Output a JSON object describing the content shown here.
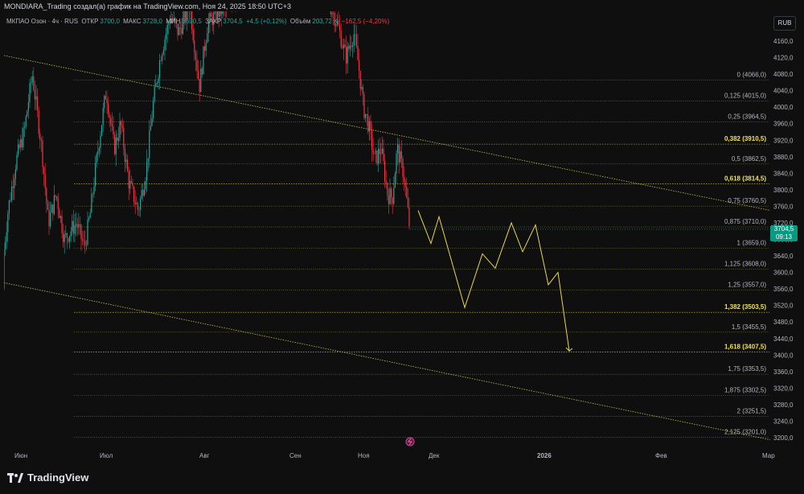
{
  "header": {
    "title": "MONDIARA_Trading создал(а) график на TradingView.com, Ноя 24, 2025 18:50 UTC+3"
  },
  "legend": {
    "symbol": "МКПАО Озон · 4ч · RUS",
    "open_label": "ОТКР",
    "open": "3700,0",
    "high_label": "МАКС",
    "high": "3728,0",
    "low_label": "МИН",
    "low": "3690,5",
    "close_label": "ЗАКР",
    "close": "3704,5",
    "change": "+4,5 (+0,12%)",
    "volume_label": "Объём",
    "volume": "203,72 K",
    "volume_change": "−162,5 (−4,20%)"
  },
  "currency": "RUB",
  "price_tag": {
    "price": "3704,5",
    "countdown": "09:13"
  },
  "footer": {
    "brand": "TradingView"
  },
  "colors": {
    "background": "#0f0f0f",
    "up": "#26a69a",
    "down": "#f23645",
    "fib_line": "#bdbd3c",
    "fib_key": "#f2e24a",
    "projection": "#e8d84a",
    "trendline": "#d9d05a"
  },
  "chart_data": {
    "type": "candlestick",
    "title": "",
    "ylim": [
      3180,
      4200
    ],
    "y_ticks": [
      "4160,0",
      "4120,0",
      "4080,0",
      "4040,0",
      "4000,0",
      "3960,0",
      "3920,0",
      "3880,0",
      "3840,0",
      "3800,0",
      "3760,0",
      "3720,0",
      "3680,0",
      "3640,0",
      "3600,0",
      "3560,0",
      "3520,0",
      "3480,0",
      "3440,0",
      "3400,0",
      "3360,0",
      "3320,0",
      "3280,0",
      "3240,0",
      "3200,0"
    ],
    "x_ticks": [
      "Июн",
      "Июл",
      "Авг",
      "Сен",
      "Ноя",
      "Дек",
      "2026",
      "Фев",
      "Мар"
    ],
    "fib_levels": [
      {
        "label": "0 (4066,0)",
        "value": 4066.0,
        "key": false
      },
      {
        "label": "0,125 (4015,0)",
        "value": 4015.0,
        "key": false
      },
      {
        "label": "0,25 (3964,5)",
        "value": 3964.5,
        "key": false
      },
      {
        "label": "0,382 (3910,5)",
        "value": 3910.5,
        "key": true
      },
      {
        "label": "0,5 (3862,5)",
        "value": 3862.5,
        "key": false
      },
      {
        "label": "0,618 (3814,5)",
        "value": 3814.5,
        "key": true
      },
      {
        "label": "0,75 (3760,5)",
        "value": 3760.5,
        "key": false
      },
      {
        "label": "0,875 (3710,0)",
        "value": 3710.0,
        "key": false
      },
      {
        "label": "1 (3659,0)",
        "value": 3659.0,
        "key": false
      },
      {
        "label": "1,125 (3608,0)",
        "value": 3608.0,
        "key": false
      },
      {
        "label": "1,25 (3557,0)",
        "value": 3557.0,
        "key": false
      },
      {
        "label": "1,382 (3503,5)",
        "value": 3503.5,
        "key": true
      },
      {
        "label": "1,5 (3455,5)",
        "value": 3455.5,
        "key": false
      },
      {
        "label": "1,618 (3407,5)",
        "value": 3407.5,
        "key": true
      },
      {
        "label": "1,75 (3353,5)",
        "value": 3353.5,
        "key": false
      },
      {
        "label": "1,875 (3302,5)",
        "value": 3302,
        "key": false
      },
      {
        "label": "2 (3251,5)",
        "value": 3251.5,
        "key": false
      },
      {
        "label": "2,125 (3201,0)",
        "value": 3201.0,
        "key": false
      }
    ],
    "price_anchors": [
      {
        "t": 0,
        "p": 3560
      },
      {
        "t": 10,
        "p": 3750
      },
      {
        "t": 20,
        "p": 3870
      },
      {
        "t": 30,
        "p": 3940
      },
      {
        "t": 40,
        "p": 4080
      },
      {
        "t": 52,
        "p": 3900
      },
      {
        "t": 60,
        "p": 3720
      },
      {
        "t": 70,
        "p": 3790
      },
      {
        "t": 80,
        "p": 3680
      },
      {
        "t": 95,
        "p": 3720
      },
      {
        "t": 105,
        "p": 3660
      },
      {
        "t": 112,
        "p": 3740
      },
      {
        "t": 122,
        "p": 3900
      },
      {
        "t": 132,
        "p": 4040
      },
      {
        "t": 142,
        "p": 3900
      },
      {
        "t": 150,
        "p": 3960
      },
      {
        "t": 160,
        "p": 3820
      },
      {
        "t": 172,
        "p": 3750
      },
      {
        "t": 182,
        "p": 3850
      },
      {
        "t": 190,
        "p": 4000
      },
      {
        "t": 200,
        "p": 4130
      },
      {
        "t": 212,
        "p": 4220
      },
      {
        "t": 222,
        "p": 4180
      },
      {
        "t": 236,
        "p": 4250
      },
      {
        "t": 248,
        "p": 4050
      },
      {
        "t": 258,
        "p": 4200
      },
      {
        "t": 270,
        "p": 4230
      },
      {
        "t": 285,
        "p": 4240
      },
      {
        "t": 300,
        "p": 4300
      },
      {
        "t": 320,
        "p": 4300
      },
      {
        "t": 340,
        "p": 4300
      },
      {
        "t": 360,
        "p": 4300
      },
      {
        "t": 380,
        "p": 4300
      },
      {
        "t": 400,
        "p": 4300
      },
      {
        "t": 420,
        "p": 4200
      },
      {
        "t": 430,
        "p": 4120
      },
      {
        "t": 440,
        "p": 4180
      },
      {
        "t": 446,
        "p": 4100
      },
      {
        "t": 452,
        "p": 4000
      },
      {
        "t": 458,
        "p": 3960
      },
      {
        "t": 466,
        "p": 3870
      },
      {
        "t": 474,
        "p": 3900
      },
      {
        "t": 482,
        "p": 3790
      },
      {
        "t": 488,
        "p": 3780
      },
      {
        "t": 494,
        "p": 3900
      },
      {
        "t": 502,
        "p": 3840
      },
      {
        "t": 510,
        "p": 3700
      }
    ],
    "projection": [
      {
        "t": 520,
        "p": 3750
      },
      {
        "t": 536,
        "p": 3670
      },
      {
        "t": 546,
        "p": 3735
      },
      {
        "t": 578,
        "p": 3515
      },
      {
        "t": 600,
        "p": 3645
      },
      {
        "t": 616,
        "p": 3610
      },
      {
        "t": 636,
        "p": 3720
      },
      {
        "t": 650,
        "p": 3650
      },
      {
        "t": 666,
        "p": 3715
      },
      {
        "t": 682,
        "p": 3570
      },
      {
        "t": 694,
        "p": 3600
      },
      {
        "t": 708,
        "p": 3410
      }
    ],
    "trendlines": [
      {
        "t1": 5,
        "p1": 4125,
        "t2": 958,
        "p2": 3750
      },
      {
        "t1": 5,
        "p1": 3575,
        "t2": 958,
        "p2": 3195
      }
    ]
  }
}
